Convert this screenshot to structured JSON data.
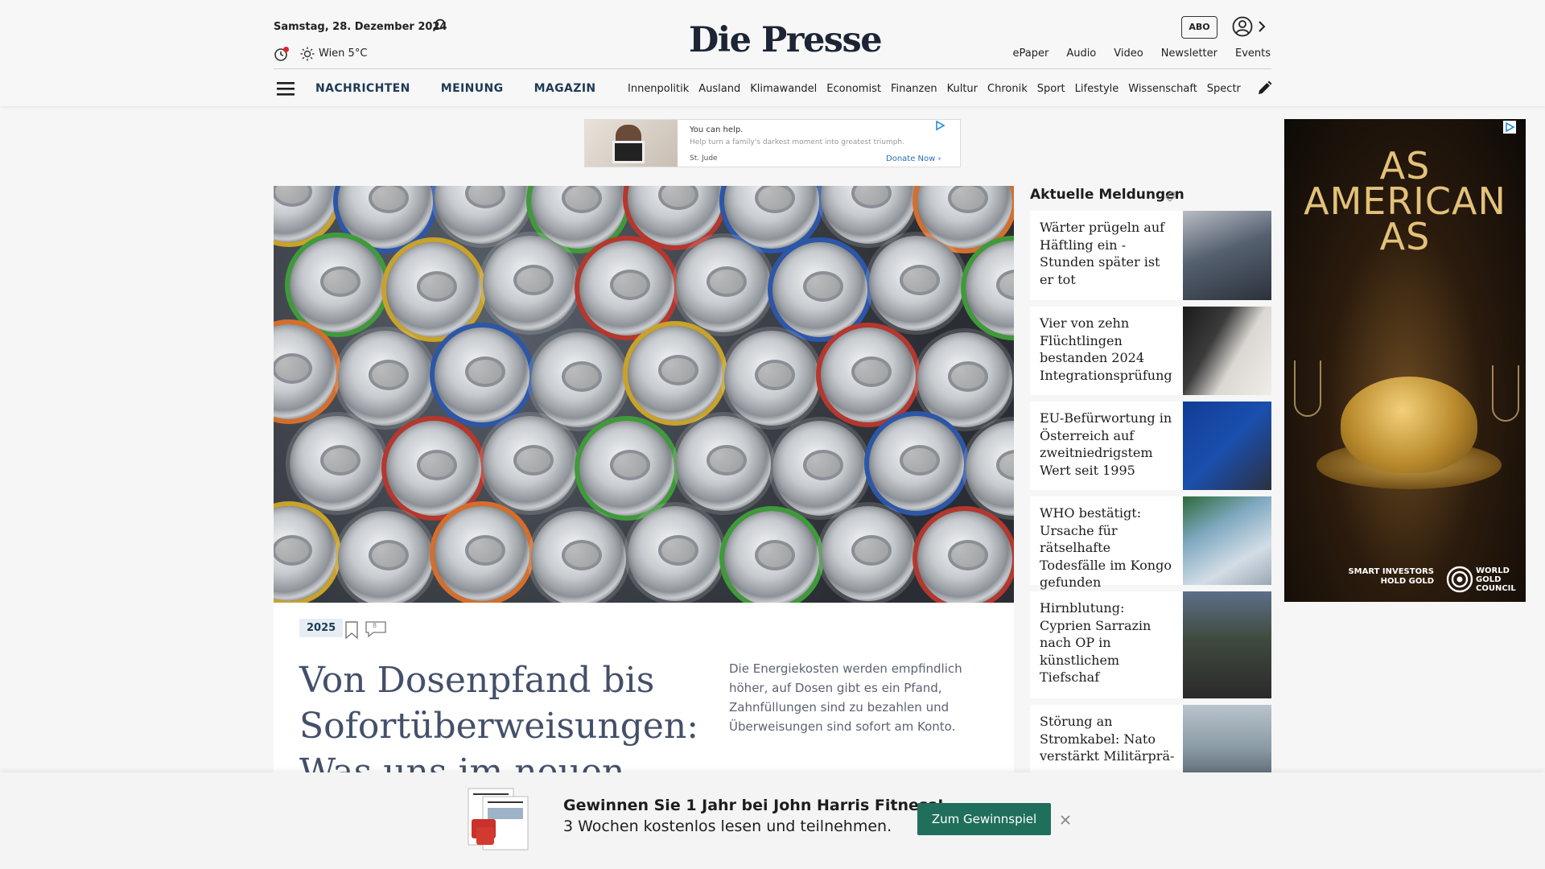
{
  "header": {
    "date": "Samstag, 28. Dezember 2024",
    "weather": "Wien 5°C",
    "logo": "Die Presse",
    "abo_label": "ABO",
    "top_links": [
      "ePaper",
      "Audio",
      "Video",
      "Newsletter",
      "Events"
    ],
    "main_nav": [
      "NACHRICHTEN",
      "MEINUNG",
      "MAGAZIN"
    ],
    "sub_nav": [
      "Innenpolitik",
      "Ausland",
      "Klimawandel",
      "Economist",
      "Finanzen",
      "Kultur",
      "Chronik",
      "Sport",
      "Lifestyle",
      "Wissenschaft",
      "Spectrum"
    ]
  },
  "top_ad": {
    "line1": "You can help.",
    "line2": "Help turn a family's darkest moment into greatest triumph.",
    "sponsor": "St. Jude",
    "cta": "Donate Now"
  },
  "article": {
    "badge": "2025",
    "comment_count": "8",
    "headline": "Von Dosenpfand bis Sofortüberweisungen: Was uns im neuen",
    "teaser": "Die Energiekosten werden empfindlich höher, auf Dosen gibt es ein Pfand, Zahnfüllungen sind zu bezahlen und Überweisungen sind sofort am Konto."
  },
  "sidebar": {
    "title": "Aktuelle Meldungen",
    "items": [
      {
        "title": "Wärter prügeln auf Häftling ein - Stunden später ist er tot"
      },
      {
        "title": "Vier von zehn Flüchtlingen bestanden 2024 Integrationsprüfung"
      },
      {
        "title": "EU-Befürwortung in Österreich auf zweitniedrigstem Wert seit 1995"
      },
      {
        "title": "WHO bestätigt: Ursache für rätselhafte Todesfälle im Kongo gefunden"
      },
      {
        "title": "Hirnblutung: Cyprien Sarrazin nach OP in künstlichem Tiefschaf"
      },
      {
        "title": "Störung an Stromkabel: Nato verstärkt Militärprä-"
      }
    ]
  },
  "sky_ad": {
    "title": "AS AMERICAN AS",
    "footer_left": "SMART INVESTORS HOLD GOLD",
    "footer_right": "WORLD GOLD COUNCIL"
  },
  "promo": {
    "line1": "Gewinnen Sie 1 Jahr bei John Harris Fitness!",
    "line2": "3 Wochen kostenlos lesen und teilnehmen.",
    "button": "Zum Gewinnspiel"
  },
  "colors": {
    "accent": "#1e3a55",
    "promo_button": "#1f6f5c",
    "headline": "#44506a"
  }
}
